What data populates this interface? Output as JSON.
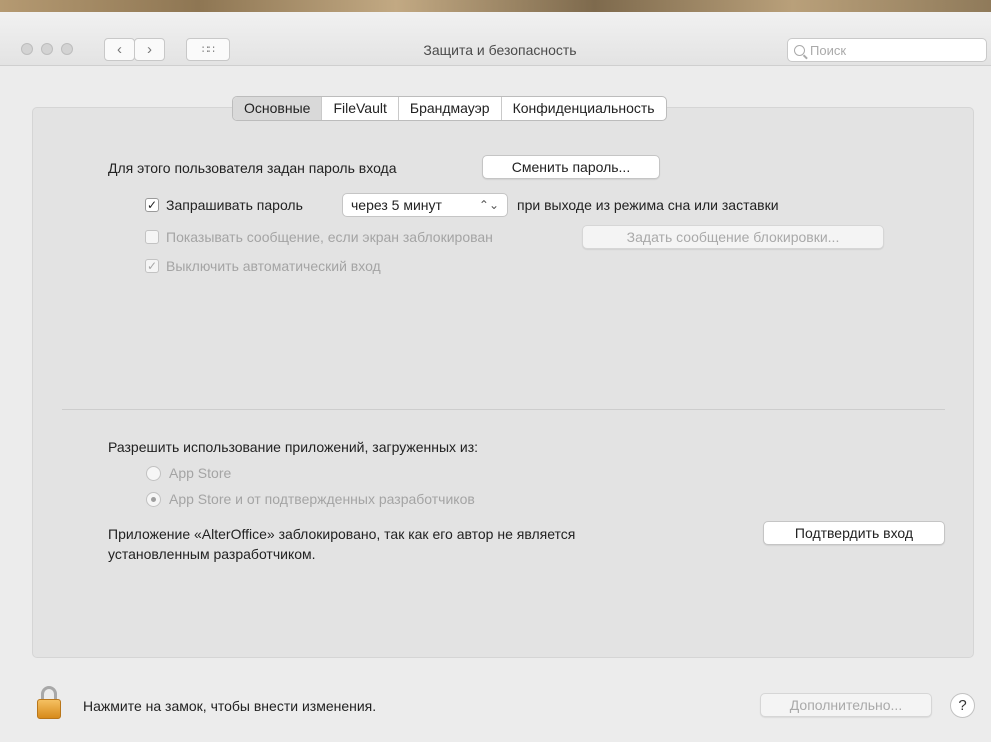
{
  "window": {
    "title": "Защита и безопасность",
    "search_placeholder": "Поиск"
  },
  "tabs": [
    {
      "label": "Основные",
      "active": true
    },
    {
      "label": "FileVault",
      "active": false
    },
    {
      "label": "Брандмауэр",
      "active": false
    },
    {
      "label": "Конфиденциальность",
      "active": false
    }
  ],
  "general": {
    "password_set_label": "Для этого пользователя задан пароль входа",
    "change_password_button": "Сменить пароль...",
    "require_password": {
      "label": "Запрашивать пароль",
      "checked": true
    },
    "require_password_delay": "через 5 минут",
    "require_password_suffix": "при выходе из режима сна или заставки",
    "show_message": {
      "label": "Показывать сообщение, если экран заблокирован",
      "checked": false,
      "enabled": false
    },
    "set_lock_message_button": "Задать сообщение блокировки...",
    "disable_autologin": {
      "label": "Выключить автоматический вход",
      "checked": true,
      "enabled": false
    }
  },
  "apps": {
    "allow_label": "Разрешить использование приложений, загруженных из:",
    "options": [
      {
        "label": "App Store",
        "selected": false
      },
      {
        "label": "App Store и от подтвержденных разработчиков",
        "selected": true
      }
    ],
    "blocked_message_line1": "Приложение «AlterOffice» заблокировано, так как его автор не является",
    "blocked_message_line2": "установленным разработчиком.",
    "confirm_button": "Подтвердить вход"
  },
  "footer": {
    "lock_text": "Нажмите на замок, чтобы внести изменения.",
    "advanced_button": "Дополнительно...",
    "help_label": "?"
  }
}
